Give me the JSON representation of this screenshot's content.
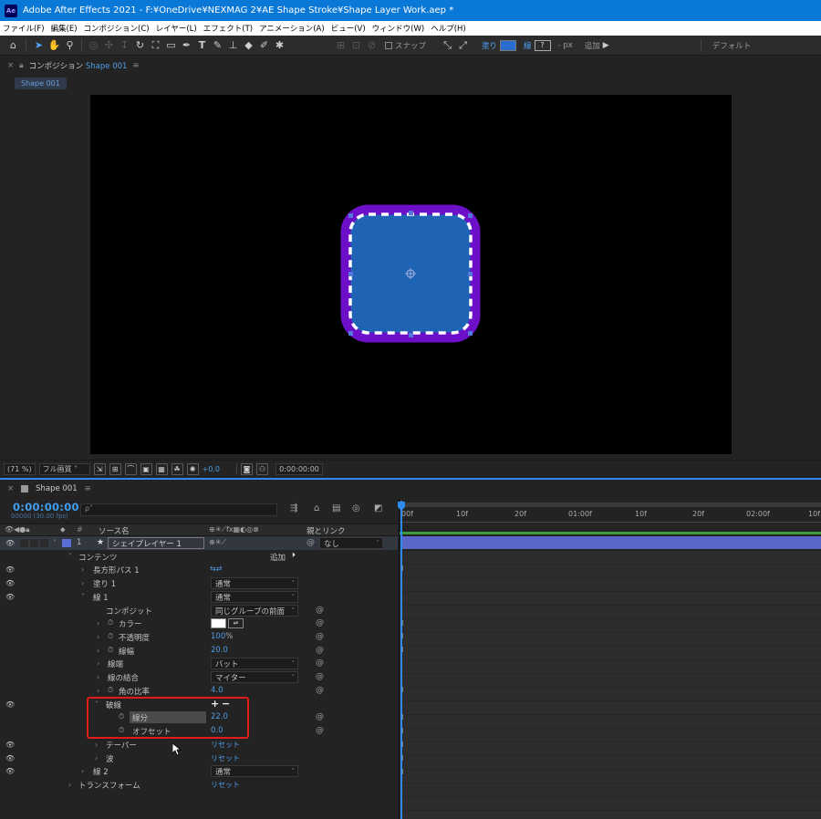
{
  "titlebar": {
    "title": "Adobe After Effects 2021 - F:¥OneDrive¥NEXMAG 2¥AE Shape Stroke¥Shape Layer Work.aep *",
    "logo_text": "Ae"
  },
  "menu": [
    "ファイル(F)",
    "編集(E)",
    "コンポジション(C)",
    "レイヤー(L)",
    "エフェクト(T)",
    "アニメーション(A)",
    "ビュー(V)",
    "ウィンドウ(W)",
    "ヘルプ(H)"
  ],
  "toolbar": {
    "snap_label": "スナップ",
    "fill_label": "塗り",
    "stroke_label": "線",
    "stroke_width": "?",
    "px_label": "- px",
    "add_label": "追加",
    "workspace": "デフォルト"
  },
  "comp_panel": {
    "panel_label": "コンポジション",
    "comp_name": "Shape 001",
    "tab_name": "Shape 001",
    "zoom": "(71 %)",
    "quality": "フル画質",
    "exposure": "+0.0",
    "timecode": "0:00:00:00"
  },
  "timeline": {
    "tab_name": "Shape 001",
    "timecode": "0:00:00:00",
    "timecode_sub": "00000 (30.00 fps)",
    "search_placeholder": "ρ˅",
    "col_source": "ソース名",
    "col_parent": "親とリンク",
    "ruler": [
      "00f",
      "10f",
      "20f",
      "01:00f",
      "10f",
      "20f",
      "02:00f",
      "10f"
    ],
    "layer": {
      "number": "1",
      "name": "シェイプレイヤー 1",
      "parent": "なし"
    },
    "contents_label": "コンテンツ",
    "add_label": "追加",
    "props": {
      "rect_path": "長方形パス 1",
      "fill1": "塗り 1",
      "fill1_mode": "通常",
      "stroke1": "線 1",
      "stroke1_mode": "通常",
      "composite": "コンポジット",
      "composite_val": "同じグループの前面",
      "color": "カラー",
      "opacity": "不透明度",
      "opacity_val": "100",
      "opacity_unit": "%",
      "stroke_width": "線幅",
      "stroke_width_val": "20.0",
      "cap": "線端",
      "cap_val": "バット",
      "join": "線の結合",
      "join_val": "マイター",
      "miter": "角の比率",
      "miter_val": "4.0",
      "dashes": "破線",
      "dash": "線分",
      "dash_val": "22.0",
      "offset": "オフセット",
      "offset_val": "0.0",
      "taper": "テーパー",
      "taper_val": "リセット",
      "wave": "波",
      "wave_val": "リセット",
      "stroke2": "線 2",
      "stroke2_mode": "通常",
      "transform": "トランスフォーム",
      "transform_val": "リセット"
    }
  },
  "colors": {
    "accent": "#2d8ceb",
    "shape_fill": "#1f64b4",
    "stroke_outer": "#6d0fc9",
    "highlight_box": "#e01b1b"
  }
}
